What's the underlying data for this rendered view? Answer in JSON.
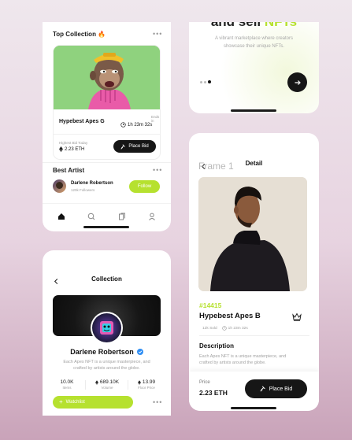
{
  "home": {
    "section_title": "Top Collection",
    "fire_emoji": "🔥",
    "more": "•••",
    "nft_name": "Hypebest Apes G",
    "ends_in_label": "Ends in",
    "ends_in_value": "1h 23m 32s",
    "highest_bid_label": "Highest Bid Today",
    "highest_bid_value": "2.23 ETH",
    "place_bid": "Place Bid",
    "best_artist_title": "Best Artist",
    "artist_name": "Darlene Robertson",
    "artist_followers": "120k Followers",
    "follow": "Follow",
    "nav_icons": [
      "home-icon",
      "search-icon",
      "collection-icon",
      "profile-icon"
    ]
  },
  "onboard": {
    "headline_dark": "and sell",
    "headline_accent": "NFTs",
    "subtitle_line1": "A vibrant marketplace where creators",
    "subtitle_line2": "showcase their unique NFTs.",
    "next_icon": "arrow-right-icon"
  },
  "detail": {
    "frame_label": "Frame 1",
    "title": "Detail",
    "token_id": "#14415",
    "name": "Hypebest Apes B",
    "meta_left": "12k Sold",
    "meta_right": "1h 23m 32s",
    "description_title": "Description",
    "description_line1": "Each Apes NFT is a unique masterpiece, and",
    "description_line2": "crafted by artists around the globe.",
    "price_label": "Price",
    "price_value": "2.23 ETH",
    "place_bid": "Place Bid"
  },
  "collection": {
    "title": "Collection",
    "name": "Darlene Robertson",
    "desc_line1": "Each Apes NFT is a unique masterpiece, and",
    "desc_line2": "crafted by artists around the globe.",
    "stats": [
      {
        "value": "10.0K",
        "label": "Items"
      },
      {
        "value": "689.10K",
        "label": "Volume"
      },
      {
        "value": "13.99",
        "label": "Floor Price"
      }
    ],
    "watchlist": "Watchlist",
    "more": "•••"
  },
  "colors": {
    "accent": "#b6e12f",
    "dark": "#161616",
    "verified": "#2f8ef4"
  }
}
